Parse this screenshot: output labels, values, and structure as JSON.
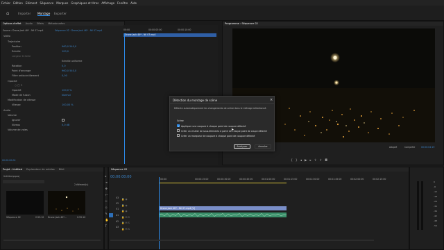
{
  "menu": [
    "Fichier",
    "Edition",
    "Elément",
    "Séquence",
    "Marques",
    "Graphiques et titres",
    "Affichage",
    "Fenêtre",
    "Aide"
  ],
  "top_tabs": [
    "Importer",
    "Montage",
    "Exporter"
  ],
  "source_panel": {
    "tabs": [
      "Options d'effet",
      "Audio",
      "Effets",
      "Métadonnées"
    ],
    "source_name": "Source : Drone Jack 4K* - Nil 07.mp4",
    "sequence_name": "Séquence 02 · Drone Jack 4K* - Nil 07.mp4",
    "time_start": "00:00",
    "time_mid": "00:00:05:00",
    "time_end": "00:00:10:00",
    "clip_label": "Drone Jack 4K* - Nil 07.mp4",
    "sections": {
      "video": "Vidéo",
      "motion": "Trajectoire",
      "position": "Position",
      "position_val": "960,0    540,0",
      "scale": "Echelle",
      "scale_val": "100,0",
      "scale_width": "Largeur échelle",
      "uniform": "Echelle uniforme",
      "rotation": "Rotation",
      "rotation_val": "0,0",
      "anchor": "Point d'ancrage",
      "anchor_val": "960,0    540,0",
      "antiflicker": "Filtre antiscintillement",
      "antiflicker_val": "0,00",
      "opacity_section": "Opacité",
      "opacity": "Opacité",
      "opacity_val": "100,0 %",
      "blend": "Mode de fusion",
      "blend_val": "Normal",
      "time_remap": "Modification de vitesse",
      "speed": "Vitesse",
      "speed_val": "100,00 %",
      "audio": "Audio",
      "volume": "Volume",
      "bypass": "Ignorer",
      "level": "Niveau",
      "level_val": "0,0 dB",
      "channel_volume": "Volume de voies"
    },
    "timecode": "00:00:00:00"
  },
  "program": {
    "title": "Programme : Séquence 02",
    "fit": "Adapté",
    "quality": "Complète",
    "timecode": "00:00:04:19"
  },
  "project": {
    "tabs": [
      "Projet : Untitled",
      "Explorateur de médias",
      "Bibli"
    ],
    "file": "Untitled.prproj",
    "count": "2 élément(s)",
    "items": [
      {
        "name": "Séquence 02",
        "duration": "2:55:10"
      },
      {
        "name": "Drone Jack 4K*...",
        "duration": "2:55:10"
      }
    ]
  },
  "timeline": {
    "tab": "Séquence 02",
    "timecode": "00:00:00:00",
    "ruler": [
      "00:00",
      "00:00:15:00",
      "00:00:30:00",
      "00:00:45:00",
      "00:01:00:00",
      "00:01:15:00",
      "00:01:30:00",
      "00:01:45:00",
      "00:02:00:00",
      "00:02:15:00",
      "00:02:30:00",
      "00:02:45:00"
    ],
    "tracks": [
      "V3",
      "V2",
      "V1",
      "A1",
      "A2",
      "A3"
    ],
    "clip_label": "Drone Jack 4K* - Nil 07.mp4 [V]"
  },
  "dialog": {
    "title": "Détection du montage de scène",
    "description": "Détecte automatiquement les changements de scène dans le métrage sélectionné.",
    "group_label": "Scène",
    "options": [
      {
        "label": "Appliquer une coupure à chaque point de coupure détecté",
        "checked": true
      },
      {
        "label": "Créer un chutier de sous-éléments à partir de chaque point de coupe détecté",
        "checked": false
      },
      {
        "label": "Créer un marqueur de coupure à chaque point de coupure détecté",
        "checked": false
      }
    ],
    "analyze_label": "Analyser",
    "cancel_label": "Annuler",
    "close_glyph": "×"
  },
  "meter_db": [
    "0",
    "-6",
    "-12",
    "-18",
    "-24",
    "-30",
    "-36",
    "-42",
    "-48",
    "-54"
  ]
}
